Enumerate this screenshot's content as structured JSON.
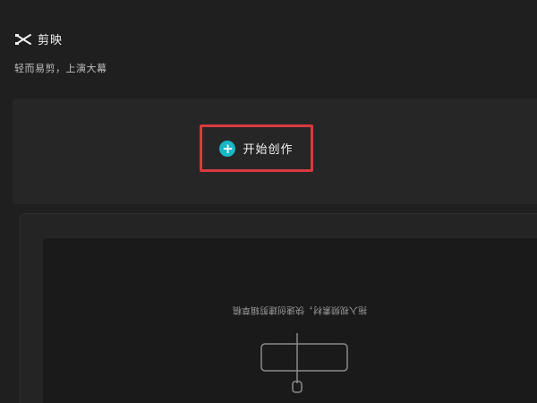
{
  "brand": {
    "name": "剪映",
    "logo_icon": "capcut-logo-icon"
  },
  "slogan": "轻而易剪，上演大幕",
  "hero": {
    "create_button": {
      "label": "开始创作",
      "icon": "plus-circle-icon",
      "icon_color": "#17b8c7",
      "highlight_color": "#d83a3f"
    }
  },
  "drafts": {
    "hint_mirrored": "拖入视频素材，快速创建剪辑草稿",
    "illustration_icon": "drag-drop-icon"
  },
  "colors": {
    "background": "#1f1f1f",
    "panel": "#262626",
    "accent": "#17b8c7"
  }
}
